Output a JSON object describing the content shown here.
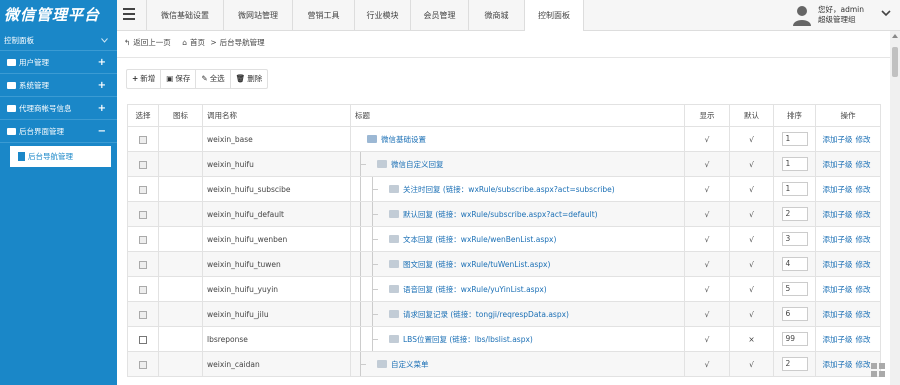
{
  "app": {
    "logo": "微信管理平台"
  },
  "nav": {
    "tabs": [
      {
        "label": "微信基础设置"
      },
      {
        "label": "微网站管理"
      },
      {
        "label": "营销工具"
      },
      {
        "label": "行业模块"
      },
      {
        "label": "会员管理"
      },
      {
        "label": "微商城"
      },
      {
        "label": "控制面板"
      }
    ]
  },
  "user": {
    "greeting": "您好，admin",
    "role": "超级管理组"
  },
  "sidebar": {
    "header": "控制面板",
    "items": [
      {
        "label": "用户管理",
        "toggle": "+"
      },
      {
        "label": "系统管理",
        "toggle": "+"
      },
      {
        "label": "代理商帐号信息",
        "toggle": "+"
      },
      {
        "label": "后台界面管理",
        "toggle": "−"
      }
    ],
    "sub_item": "后台导航管理"
  },
  "breadcrumb": {
    "back": "返回上一页",
    "home": "首页",
    "current": "后台导航管理",
    "sep": ">"
  },
  "toolbar": {
    "add": "新增",
    "save": "保存",
    "select_all": "全选",
    "delete": "删除"
  },
  "table": {
    "headers": [
      "选择",
      "图标",
      "调用名称",
      "标题",
      "显示",
      "默认",
      "排序",
      "操作"
    ],
    "op_add": "添加子级",
    "op_edit": "修改",
    "rows": [
      {
        "name": "weixin_base",
        "title": "微信基础设置",
        "show": "√",
        "default": "√",
        "sort": "1",
        "level": 0
      },
      {
        "name": "weixin_huifu",
        "title": "微信自定义回复",
        "show": "√",
        "default": "√",
        "sort": "1",
        "level": 1
      },
      {
        "name": "weixin_huifu_subscibe",
        "title": "关注时回复 (链接：wxRule/subscribe.aspx?act=subscribe)",
        "show": "√",
        "default": "√",
        "sort": "1",
        "level": 2
      },
      {
        "name": "weixin_huifu_default",
        "title": "默认回复 (链接：wxRule/subscribe.aspx?act=default)",
        "show": "√",
        "default": "√",
        "sort": "2",
        "level": 2
      },
      {
        "name": "weixin_huifu_wenben",
        "title": "文本回复 (链接：wxRule/wenBenList.aspx)",
        "show": "√",
        "default": "√",
        "sort": "3",
        "level": 2
      },
      {
        "name": "weixin_huifu_tuwen",
        "title": "图文回复 (链接：wxRule/tuWenList.aspx)",
        "show": "√",
        "default": "√",
        "sort": "4",
        "level": 2
      },
      {
        "name": "weixin_huifu_yuyin",
        "title": "语音回复 (链接：wxRule/yuYinList.aspx)",
        "show": "√",
        "default": "√",
        "sort": "5",
        "level": 2
      },
      {
        "name": "weixin_huifu_jilu",
        "title": "请求回复记录 (链接：tongji/reqrespData.aspx)",
        "show": "√",
        "default": "√",
        "sort": "6",
        "level": 2
      },
      {
        "name": "lbsreponse",
        "title": "LBS位置回复 (链接：lbs/lbslist.aspx)",
        "show": "√",
        "default": "×",
        "sort": "99",
        "level": 2
      },
      {
        "name": "weixin_caidan",
        "title": "自定义菜单",
        "show": "√",
        "default": "√",
        "sort": "2",
        "level": 1
      }
    ]
  },
  "colors": {
    "brand": "#1a87c8",
    "link": "#1a6fb5"
  }
}
